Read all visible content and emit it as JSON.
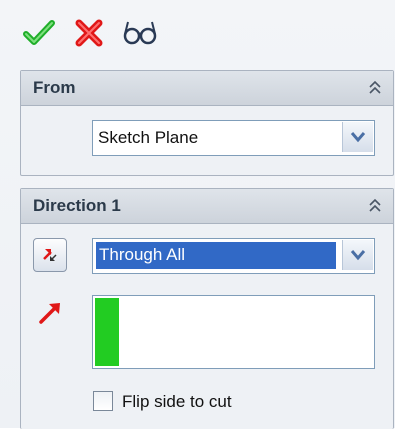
{
  "toolbar": {
    "ok_icon": "check-icon",
    "cancel_icon": "x-icon",
    "preview_icon": "eyeglasses-icon",
    "ok_color": "#1fae2a",
    "cancel_color": "#e01818"
  },
  "from_group": {
    "title": "From",
    "start_condition": "Sketch Plane"
  },
  "direction1_group": {
    "title": "Direction 1",
    "end_condition": "Through All",
    "reverse_direction_icon": "reverse-direction-icon",
    "direction_arrow_icon": "direction-arrow-icon",
    "flip_side_to_cut": {
      "label": "Flip side to cut",
      "checked": false
    }
  },
  "colors": {
    "selection": "#3169c6",
    "depth_fill": "#22cc22",
    "header_text": "#2b3a4a"
  }
}
